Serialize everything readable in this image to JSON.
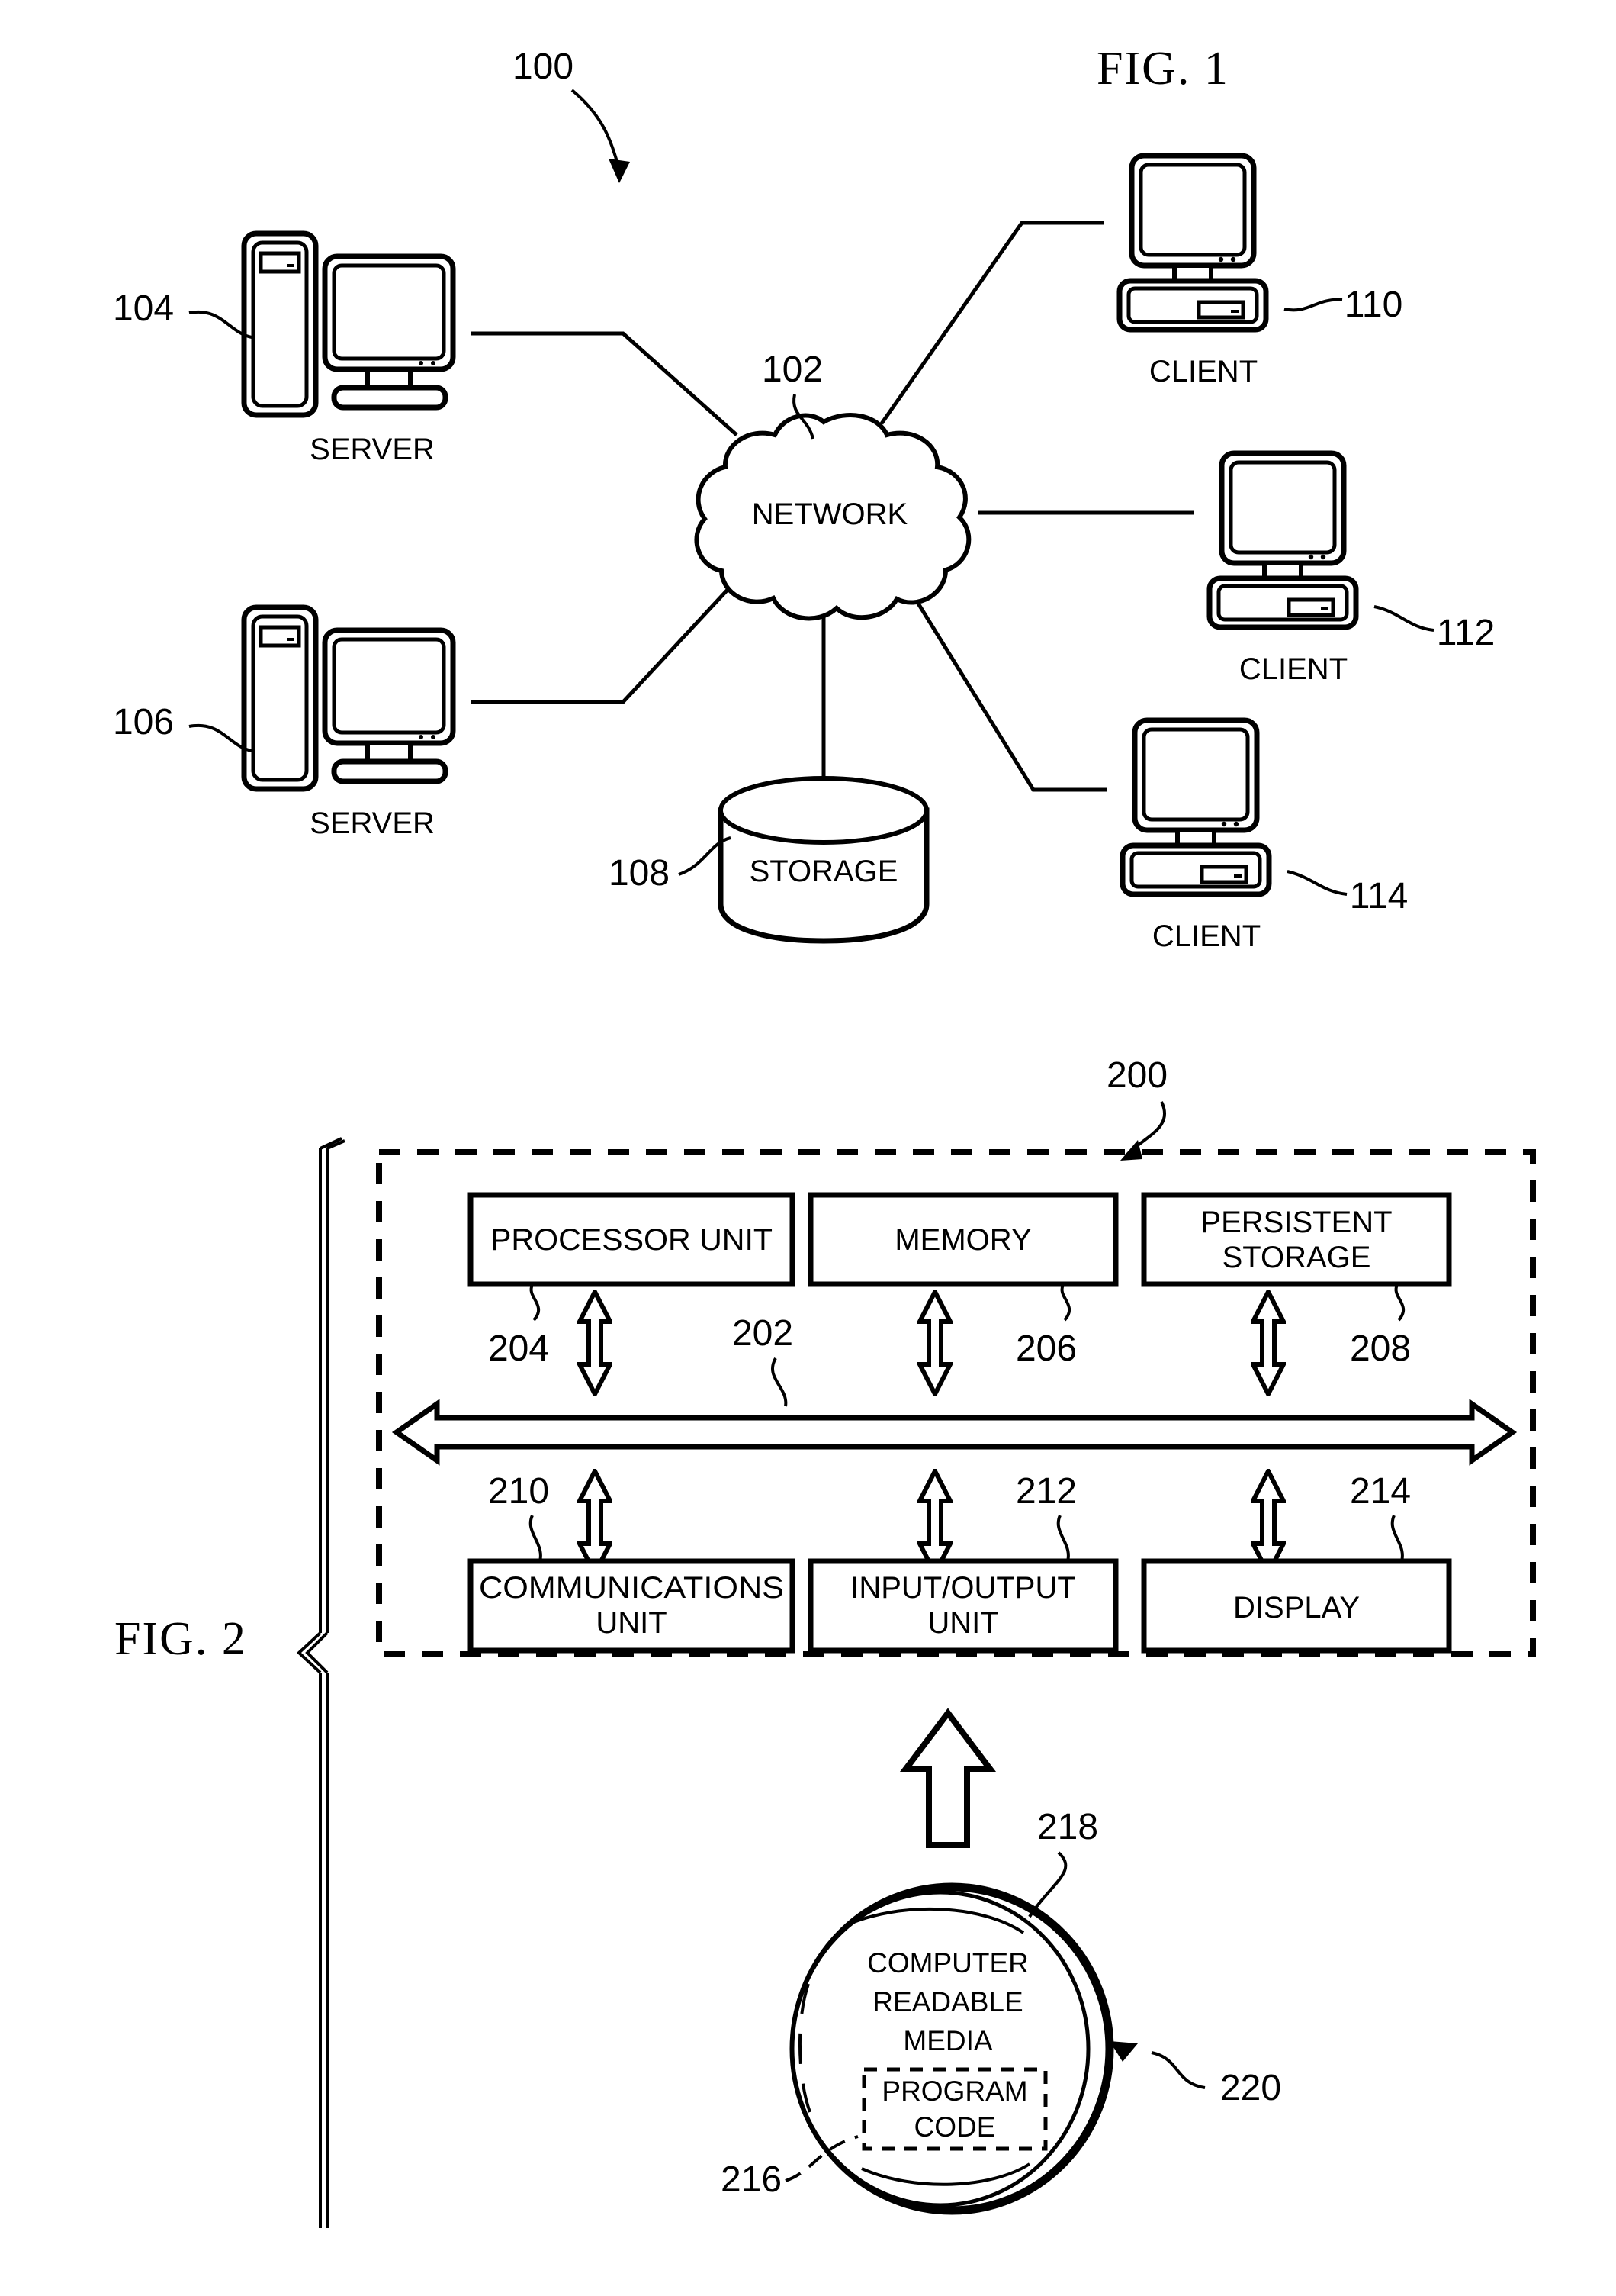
{
  "figures": [
    {
      "id": "fig1",
      "label": "FIG. 1",
      "system_ref": "100",
      "nodes": {
        "network": {
          "label": "NETWORK",
          "ref": "102"
        },
        "server_top": {
          "label": "SERVER",
          "ref": "104"
        },
        "server_bottom": {
          "label": "SERVER",
          "ref": "106"
        },
        "storage": {
          "label": "STORAGE",
          "ref": "108"
        },
        "client_top": {
          "label": "CLIENT",
          "ref": "110"
        },
        "client_mid": {
          "label": "CLIENT",
          "ref": "112"
        },
        "client_bottom": {
          "label": "CLIENT",
          "ref": "114"
        }
      }
    },
    {
      "id": "fig2",
      "label": "FIG. 2",
      "system_ref": "200",
      "bus_ref": "202",
      "blocks_top": [
        {
          "label": "PROCESSOR UNIT",
          "ref": "204",
          "lines": [
            "PROCESSOR UNIT"
          ]
        },
        {
          "label": "MEMORY",
          "ref": "206",
          "lines": [
            "MEMORY"
          ]
        },
        {
          "label": "PERSISTENT STORAGE",
          "ref": "208",
          "lines": [
            "PERSISTENT",
            "STORAGE"
          ]
        }
      ],
      "blocks_bottom": [
        {
          "label": "COMMUNICATIONS UNIT",
          "ref": "210",
          "lines": [
            "COMMUNICATIONS",
            "UNIT"
          ]
        },
        {
          "label": "INPUT/OUTPUT UNIT",
          "ref": "212",
          "lines": [
            "INPUT/OUTPUT",
            "UNIT"
          ]
        },
        {
          "label": "DISPLAY",
          "ref": "214",
          "lines": [
            "DISPLAY"
          ]
        }
      ],
      "media": {
        "lines": [
          "COMPUTER",
          "READABLE",
          "MEDIA"
        ],
        "program_code_lines": [
          "PROGRAM",
          "CODE"
        ],
        "ref_program_code": "216",
        "ref_media": "218",
        "ref_disc": "220"
      }
    }
  ],
  "colors": {
    "ink": "#000000",
    "paper": "#ffffff"
  }
}
